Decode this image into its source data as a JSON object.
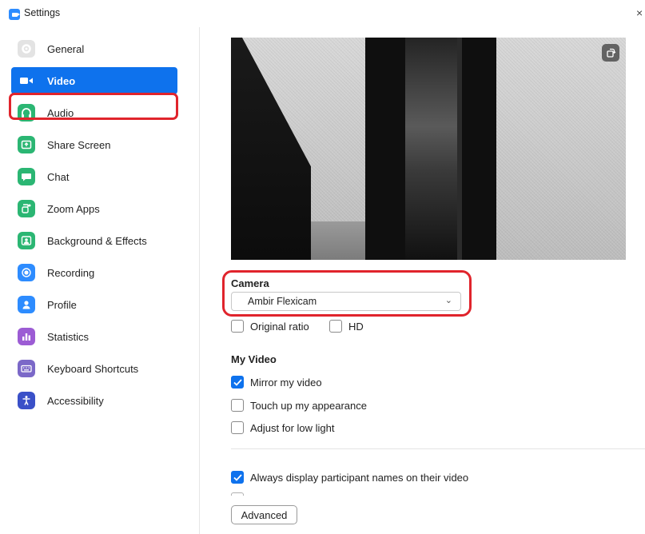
{
  "window": {
    "title": "Settings",
    "close_glyph": "×",
    "icon": "zoom-camera-icon"
  },
  "sidebar": {
    "items": [
      {
        "label": "General",
        "icon": "gear-icon",
        "color": "#e0e0e0",
        "active": false
      },
      {
        "label": "Video",
        "icon": "video-camera-icon",
        "color": "#0e72ed",
        "active": true
      },
      {
        "label": "Audio",
        "icon": "headphones-icon",
        "color": "#2bb673",
        "active": false
      },
      {
        "label": "Share Screen",
        "icon": "share-screen-icon",
        "color": "#2bb673",
        "active": false
      },
      {
        "label": "Chat",
        "icon": "chat-bubble-icon",
        "color": "#2bb673",
        "active": false
      },
      {
        "label": "Zoom Apps",
        "icon": "apps-icon",
        "color": "#2bb673",
        "active": false
      },
      {
        "label": "Background & Effects",
        "icon": "person-background-icon",
        "color": "#2bb673",
        "active": false
      },
      {
        "label": "Recording",
        "icon": "record-icon",
        "color": "#2d8cff",
        "active": false
      },
      {
        "label": "Profile",
        "icon": "profile-icon",
        "color": "#2d8cff",
        "active": false
      },
      {
        "label": "Statistics",
        "icon": "bar-chart-icon",
        "color": "#9c5cd4",
        "active": false
      },
      {
        "label": "Keyboard Shortcuts",
        "icon": "keyboard-icon",
        "color": "#7b68c8",
        "active": false
      },
      {
        "label": "Accessibility",
        "icon": "accessibility-icon",
        "color": "#3a50c8",
        "active": false
      }
    ]
  },
  "video": {
    "camera_label": "Camera",
    "camera_selected": "Ambir Flexicam",
    "original_ratio_label": "Original ratio",
    "original_ratio_checked": false,
    "hd_label": "HD",
    "hd_checked": false,
    "my_video_title": "My Video",
    "mirror_label": "Mirror my video",
    "mirror_checked": true,
    "touch_up_label": "Touch up my appearance",
    "touch_up_checked": false,
    "low_light_label": "Adjust for low light",
    "low_light_checked": false,
    "participant_names_label": "Always display participant names on their video",
    "participant_names_checked": true,
    "advanced_label": "Advanced"
  },
  "colors": {
    "accent": "#0e72ed",
    "highlight_outline": "#e0242c"
  }
}
